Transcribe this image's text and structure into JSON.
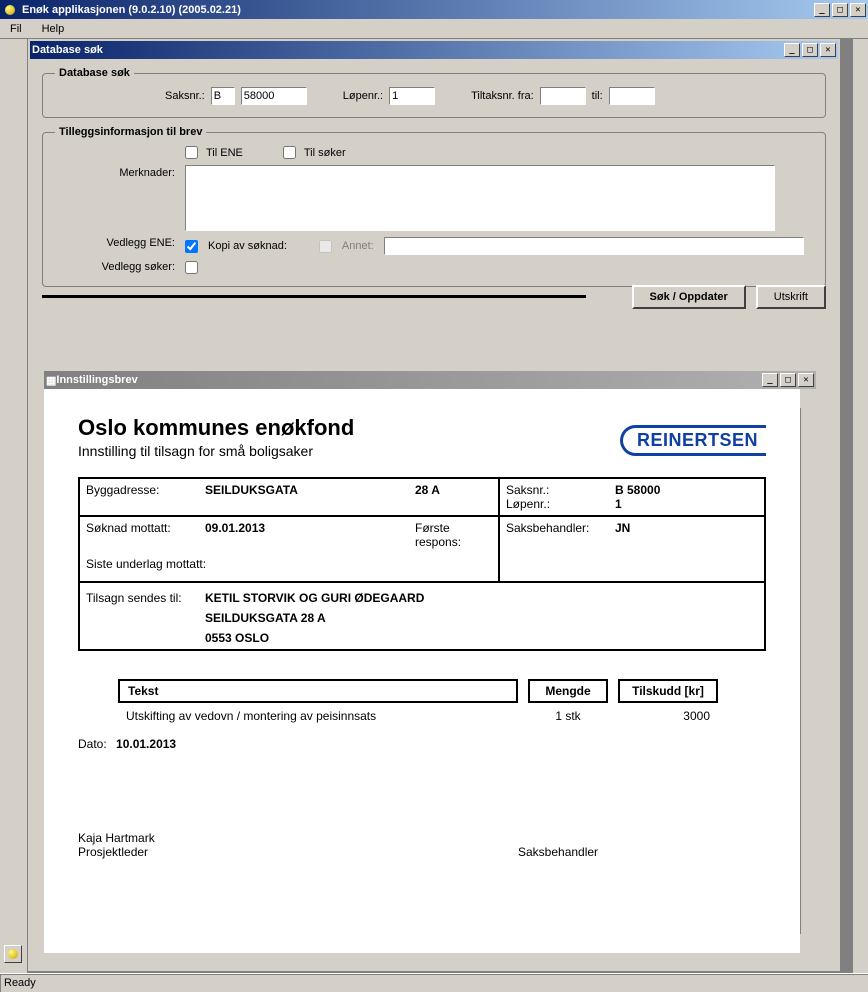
{
  "app": {
    "title": "Enøk applikasjonen  (9.0.2.10) (2005.02.21)",
    "menu": {
      "file": "Fil",
      "help": "Help"
    },
    "status": "Ready"
  },
  "dbWindow": {
    "title": "Database søk",
    "search": {
      "legend": "Database søk",
      "saksnr_label": "Saksnr.:",
      "saksnr_prefix": "B",
      "saksnr_num": "58000",
      "lopenr_label": "Løpenr.:",
      "lopenr_val": "1",
      "tiltaknr_fra_label": "Tiltaksnr. fra:",
      "tiltaknr_fra_val": "",
      "til_label": "til:",
      "til_val": ""
    },
    "extra": {
      "legend": "Tilleggsinformasjon til brev",
      "til_ene": "Til ENE",
      "til_soker": "Til søker",
      "merknader_label": "Merknader:",
      "merknader_val": "",
      "vedlegg_ene_label": "Vedlegg ENE:",
      "kopi_label": "Kopi av søknad:",
      "annet_label": "Annet:",
      "annet_val": "",
      "vedlegg_soker_label": "Vedlegg søker:"
    },
    "buttons": {
      "sok": "Søk / Oppdater",
      "utskrift": "Utskrift"
    }
  },
  "previewWindow": {
    "title": "Innstillingsbrev",
    "report": {
      "heading": "Oslo kommunes enøkfond",
      "subheading": "Innstilling til tilsagn for små boligsaker",
      "brand": "REINERTSEN",
      "fields": {
        "byggadresse_label": "Byggadresse:",
        "byggadresse_val": "SEILDUKSGATA",
        "byggadresse_num": "28 A",
        "saksnr_label": "Saksnr.:",
        "saksnr_val": "B  58000",
        "lopenr_label": "Løpenr.:",
        "lopenr_val": "1",
        "soknad_mottatt_label": "Søknad mottatt:",
        "soknad_mottatt_val": "09.01.2013",
        "forste_respons_label": "Første respons:",
        "forste_respons_val": "",
        "siste_underlag_label": "Siste underlag mottatt:",
        "siste_underlag_val": "",
        "saksbehandler_label": "Saksbehandler:",
        "saksbehandler_val": "JN",
        "tilsagn_label": "Tilsagn sendes til:",
        "tilsagn_name": "KETIL STORVIK OG GURI ØDEGAARD",
        "tilsagn_addr": "SEILDUKSGATA 28 A",
        "tilsagn_city": "0553   OSLO"
      },
      "columns": {
        "tekst": "Tekst",
        "mengde": "Mengde",
        "tilskudd": "Tilskudd [kr]"
      },
      "line": {
        "tekst": "Utskifting av vedovn / montering av peisinnsats",
        "mengde": "1 stk",
        "tilskudd": "3000"
      },
      "dato_label": "Dato:",
      "dato_val": "10.01.2013",
      "sign_left_name": "Kaja Hartmark",
      "sign_left_role": "Prosjektleder",
      "sign_right_role": "Saksbehandler"
    }
  }
}
